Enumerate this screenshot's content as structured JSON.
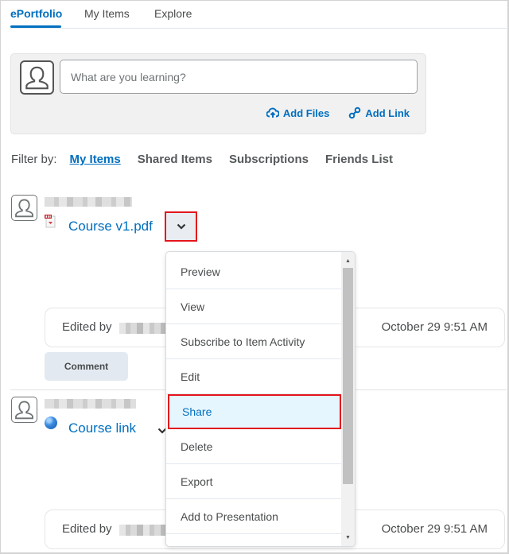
{
  "tabs": [
    {
      "label": "ePortfolio",
      "active": true
    },
    {
      "label": "My Items",
      "active": false
    },
    {
      "label": "Explore",
      "active": false
    }
  ],
  "composer": {
    "placeholder": "What are you learning?",
    "value": "",
    "add_files_label": "Add Files",
    "add_link_label": "Add Link"
  },
  "filter": {
    "label": "Filter by:",
    "options": [
      {
        "label": "My Items",
        "active": true
      },
      {
        "label": "Shared Items",
        "active": false
      },
      {
        "label": "Subscriptions",
        "active": false
      },
      {
        "label": "Friends List",
        "active": false
      }
    ]
  },
  "items": [
    {
      "author": "[blurred]",
      "title": "Course v1.pdf",
      "type_icon": "pdf-file-icon",
      "edited_label": "Edited by",
      "edited_by": "[blurred]",
      "date": "October 29 9:51 AM",
      "comment_label": "Comment"
    },
    {
      "author": "[blurred]",
      "title": "Course link",
      "type_icon": "globe-link-icon",
      "edited_label": "Edited by",
      "edited_by": "[blurred]",
      "date": "October 29 9:51 AM"
    }
  ],
  "context_menu": {
    "items": [
      {
        "label": "Preview"
      },
      {
        "label": "View"
      },
      {
        "label": "Subscribe to Item Activity"
      },
      {
        "label": "Edit"
      },
      {
        "label": "Share",
        "highlighted": true
      },
      {
        "label": "Delete"
      },
      {
        "label": "Export"
      },
      {
        "label": "Add to Presentation"
      }
    ]
  },
  "colors": {
    "accent": "#006fbf",
    "highlight_border": "#e3151b",
    "highlight_bg": "#e6f6ff",
    "text": "#494c4e"
  }
}
